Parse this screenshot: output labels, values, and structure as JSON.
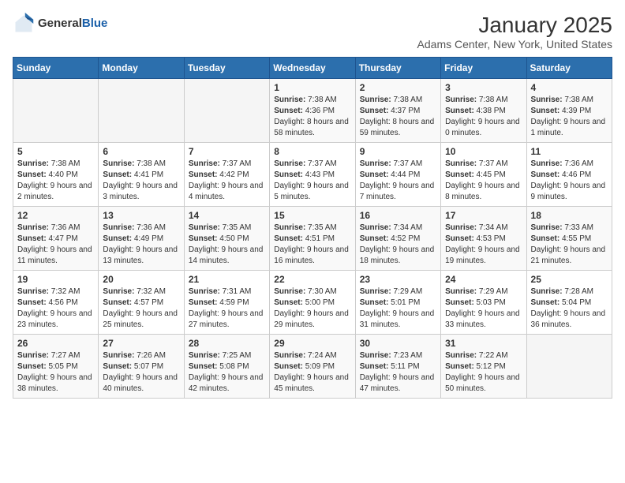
{
  "logo": {
    "general": "General",
    "blue": "Blue"
  },
  "title": "January 2025",
  "subtitle": "Adams Center, New York, United States",
  "days_of_week": [
    "Sunday",
    "Monday",
    "Tuesday",
    "Wednesday",
    "Thursday",
    "Friday",
    "Saturday"
  ],
  "weeks": [
    [
      {
        "day": "",
        "content": ""
      },
      {
        "day": "",
        "content": ""
      },
      {
        "day": "",
        "content": ""
      },
      {
        "day": "1",
        "content": "Sunrise: 7:38 AM\nSunset: 4:36 PM\nDaylight: 8 hours and 58 minutes."
      },
      {
        "day": "2",
        "content": "Sunrise: 7:38 AM\nSunset: 4:37 PM\nDaylight: 8 hours and 59 minutes."
      },
      {
        "day": "3",
        "content": "Sunrise: 7:38 AM\nSunset: 4:38 PM\nDaylight: 9 hours and 0 minutes."
      },
      {
        "day": "4",
        "content": "Sunrise: 7:38 AM\nSunset: 4:39 PM\nDaylight: 9 hours and 1 minute."
      }
    ],
    [
      {
        "day": "5",
        "content": "Sunrise: 7:38 AM\nSunset: 4:40 PM\nDaylight: 9 hours and 2 minutes."
      },
      {
        "day": "6",
        "content": "Sunrise: 7:38 AM\nSunset: 4:41 PM\nDaylight: 9 hours and 3 minutes."
      },
      {
        "day": "7",
        "content": "Sunrise: 7:37 AM\nSunset: 4:42 PM\nDaylight: 9 hours and 4 minutes."
      },
      {
        "day": "8",
        "content": "Sunrise: 7:37 AM\nSunset: 4:43 PM\nDaylight: 9 hours and 5 minutes."
      },
      {
        "day": "9",
        "content": "Sunrise: 7:37 AM\nSunset: 4:44 PM\nDaylight: 9 hours and 7 minutes."
      },
      {
        "day": "10",
        "content": "Sunrise: 7:37 AM\nSunset: 4:45 PM\nDaylight: 9 hours and 8 minutes."
      },
      {
        "day": "11",
        "content": "Sunrise: 7:36 AM\nSunset: 4:46 PM\nDaylight: 9 hours and 9 minutes."
      }
    ],
    [
      {
        "day": "12",
        "content": "Sunrise: 7:36 AM\nSunset: 4:47 PM\nDaylight: 9 hours and 11 minutes."
      },
      {
        "day": "13",
        "content": "Sunrise: 7:36 AM\nSunset: 4:49 PM\nDaylight: 9 hours and 13 minutes."
      },
      {
        "day": "14",
        "content": "Sunrise: 7:35 AM\nSunset: 4:50 PM\nDaylight: 9 hours and 14 minutes."
      },
      {
        "day": "15",
        "content": "Sunrise: 7:35 AM\nSunset: 4:51 PM\nDaylight: 9 hours and 16 minutes."
      },
      {
        "day": "16",
        "content": "Sunrise: 7:34 AM\nSunset: 4:52 PM\nDaylight: 9 hours and 18 minutes."
      },
      {
        "day": "17",
        "content": "Sunrise: 7:34 AM\nSunset: 4:53 PM\nDaylight: 9 hours and 19 minutes."
      },
      {
        "day": "18",
        "content": "Sunrise: 7:33 AM\nSunset: 4:55 PM\nDaylight: 9 hours and 21 minutes."
      }
    ],
    [
      {
        "day": "19",
        "content": "Sunrise: 7:32 AM\nSunset: 4:56 PM\nDaylight: 9 hours and 23 minutes."
      },
      {
        "day": "20",
        "content": "Sunrise: 7:32 AM\nSunset: 4:57 PM\nDaylight: 9 hours and 25 minutes."
      },
      {
        "day": "21",
        "content": "Sunrise: 7:31 AM\nSunset: 4:59 PM\nDaylight: 9 hours and 27 minutes."
      },
      {
        "day": "22",
        "content": "Sunrise: 7:30 AM\nSunset: 5:00 PM\nDaylight: 9 hours and 29 minutes."
      },
      {
        "day": "23",
        "content": "Sunrise: 7:29 AM\nSunset: 5:01 PM\nDaylight: 9 hours and 31 minutes."
      },
      {
        "day": "24",
        "content": "Sunrise: 7:29 AM\nSunset: 5:03 PM\nDaylight: 9 hours and 33 minutes."
      },
      {
        "day": "25",
        "content": "Sunrise: 7:28 AM\nSunset: 5:04 PM\nDaylight: 9 hours and 36 minutes."
      }
    ],
    [
      {
        "day": "26",
        "content": "Sunrise: 7:27 AM\nSunset: 5:05 PM\nDaylight: 9 hours and 38 minutes."
      },
      {
        "day": "27",
        "content": "Sunrise: 7:26 AM\nSunset: 5:07 PM\nDaylight: 9 hours and 40 minutes."
      },
      {
        "day": "28",
        "content": "Sunrise: 7:25 AM\nSunset: 5:08 PM\nDaylight: 9 hours and 42 minutes."
      },
      {
        "day": "29",
        "content": "Sunrise: 7:24 AM\nSunset: 5:09 PM\nDaylight: 9 hours and 45 minutes."
      },
      {
        "day": "30",
        "content": "Sunrise: 7:23 AM\nSunset: 5:11 PM\nDaylight: 9 hours and 47 minutes."
      },
      {
        "day": "31",
        "content": "Sunrise: 7:22 AM\nSunset: 5:12 PM\nDaylight: 9 hours and 50 minutes."
      },
      {
        "day": "",
        "content": ""
      }
    ]
  ]
}
